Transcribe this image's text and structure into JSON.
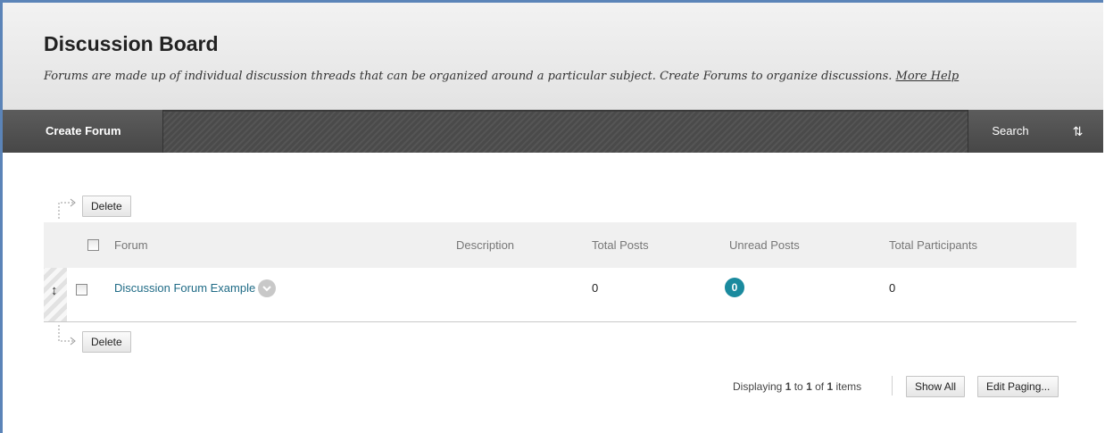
{
  "header": {
    "title": "Discussion Board",
    "description": "Forums are made up of individual discussion threads that can be organized around a particular subject. Create Forums to organize discussions.",
    "help_link": "More Help"
  },
  "action_bar": {
    "create_forum": "Create Forum",
    "search": "Search",
    "sort_icon": "sort-arrows-icon",
    "sort_glyph": "⇅"
  },
  "bulk_actions": {
    "delete_top": "Delete",
    "delete_bottom": "Delete"
  },
  "table": {
    "columns": [
      "Forum",
      "Description",
      "Total Posts",
      "Unread Posts",
      "Total Participants"
    ],
    "rows": [
      {
        "forum": "Discussion Forum Example",
        "description": "",
        "total_posts": "0",
        "unread_posts": "0",
        "total_participants": "0"
      }
    ]
  },
  "paging": {
    "prefix": "Displaying ",
    "from": "1",
    "to_word": " to ",
    "to": "1",
    "of_word": " of ",
    "total": "1",
    "suffix": " items",
    "show_all": "Show All",
    "edit_paging": "Edit Paging..."
  },
  "colors": {
    "accent_teal": "#1a8a9e",
    "link": "#1f6b86",
    "action_bar": "#4e4e4e",
    "frame_border": "#5b84b8"
  }
}
